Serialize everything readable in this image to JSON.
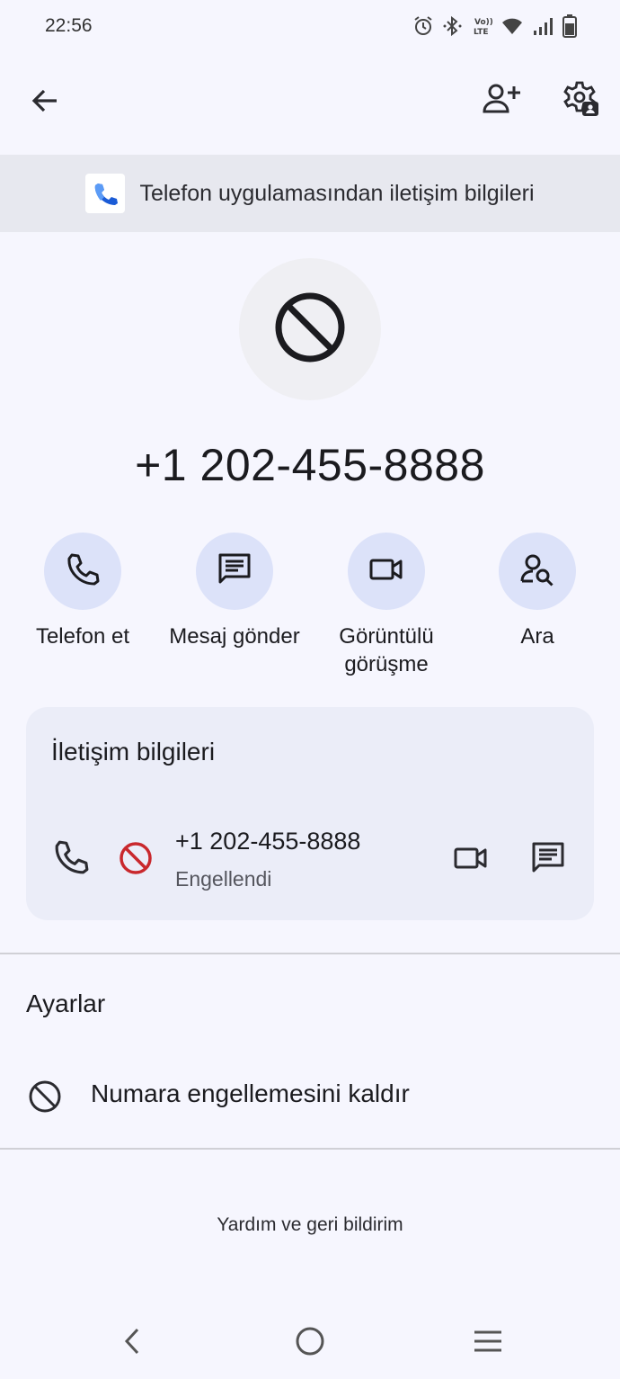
{
  "status_bar": {
    "time": "22:56",
    "icons": [
      "alarm-icon",
      "bluetooth-icon",
      "volte-icon",
      "wifi-icon",
      "signal-icon",
      "battery-icon"
    ]
  },
  "top_bar": {
    "icons": [
      "back-arrow-icon",
      "add-contact-icon",
      "contact-settings-icon"
    ]
  },
  "banner": {
    "text": "Telefon uygulamasından iletişim bilgileri",
    "icon": "phone-app-icon"
  },
  "contact": {
    "avatar_icon": "blocked-icon",
    "number": "+1 202-455-8888"
  },
  "actions": [
    {
      "label": "Telefon et",
      "icon": "phone-icon"
    },
    {
      "label": "Mesaj gönder",
      "icon": "message-icon"
    },
    {
      "label": "Görüntülü görüşme",
      "icon": "video-icon"
    },
    {
      "label": "Ara",
      "icon": "search-person-icon"
    }
  ],
  "contact_info": {
    "title": "İletişim bilgileri",
    "number": "+1 202-455-8888",
    "status": "Engellendi"
  },
  "settings": {
    "title": "Ayarlar",
    "unblock_label": "Numara engellemesini kaldır"
  },
  "footer": {
    "help_label": "Yardım ve geri bildirim"
  },
  "colors": {
    "background": "#f6f6fe",
    "action_circle": "#dce2f9",
    "card": "#ebedf8",
    "blocked_red": "#c9282d",
    "banner": "#e7e8ef"
  }
}
